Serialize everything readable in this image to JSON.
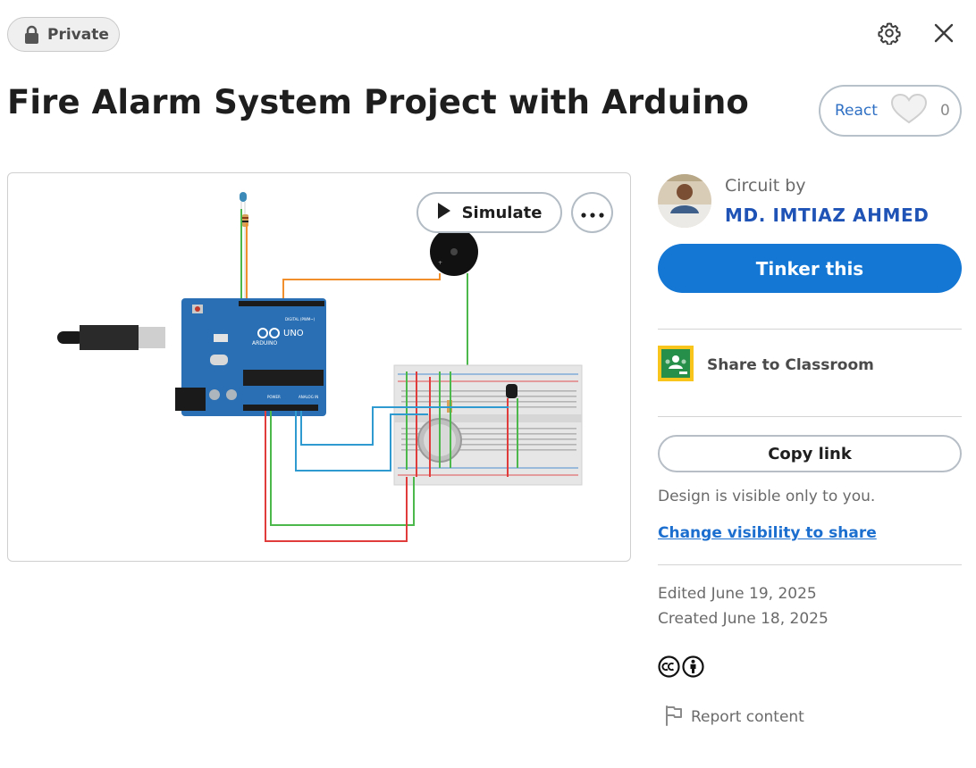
{
  "header": {
    "privacy_label": "Private",
    "privacy_icon": "lock-icon",
    "settings_icon": "gear-icon",
    "close_icon": "close-icon"
  },
  "project": {
    "title": "Fire Alarm System Project with Arduino"
  },
  "reactions": {
    "label": "React",
    "icon": "heart-icon",
    "count": "0"
  },
  "viewer": {
    "simulate_label": "Simulate",
    "simulate_icon": "play-icon",
    "more_icon": "more-dots-icon",
    "board": {
      "logo": "ARDUINO",
      "model": "UNO",
      "digital_label": "DIGITAL (PWM~)",
      "power_label": "POWER",
      "analog_label": "ANALOG IN"
    }
  },
  "author": {
    "caption": "Circuit by",
    "name": "MD. IMTIAZ AHMED"
  },
  "actions": {
    "tinker_label": "Tinker this",
    "classroom_label": "Share to Classroom",
    "classroom_icon": "google-classroom-icon",
    "copy_link_label": "Copy link"
  },
  "visibility": {
    "note": "Design is visible only to you.",
    "change_link": "Change visibility to share"
  },
  "dates": {
    "edited": "Edited June 19, 2025",
    "created": "Created June 18, 2025"
  },
  "license": {
    "icons": [
      "cc-icon",
      "by-attribution-icon"
    ]
  },
  "report": {
    "label": "Report content",
    "icon": "flag-icon"
  },
  "colors": {
    "primary_button": "#1477d4",
    "author_link": "#1f53b5",
    "link": "#1d6fcf",
    "board_blue": "#2a6fb3"
  }
}
